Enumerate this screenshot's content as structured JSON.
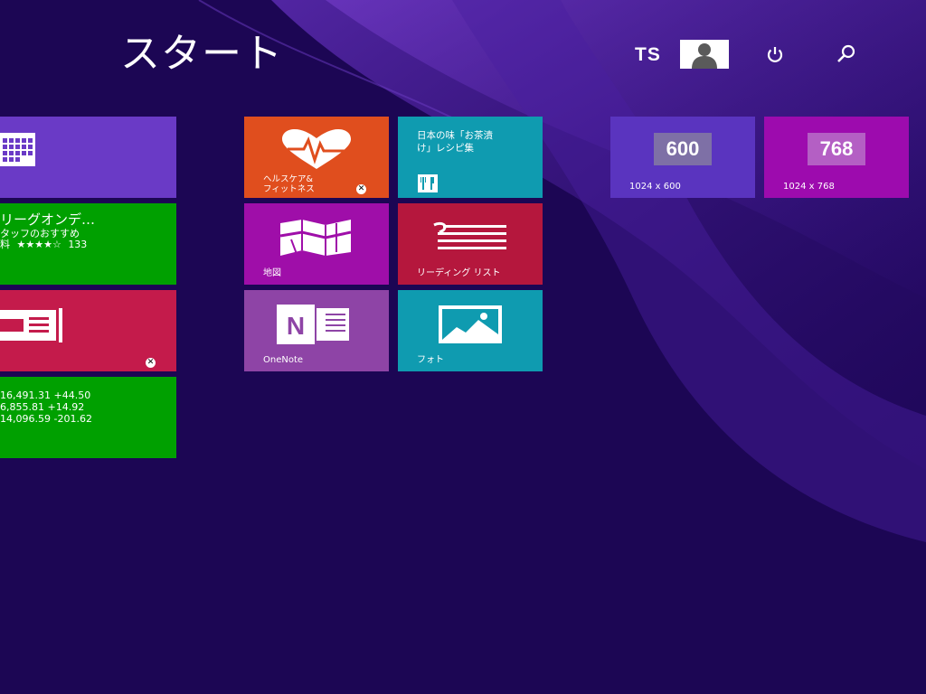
{
  "header": {
    "title": "スタート",
    "user_initials": "TS"
  },
  "colors": {
    "background": "#1c0654",
    "tile_purple": "#6a3ac6",
    "tile_green": "#00a000",
    "tile_crimson": "#c41b4b",
    "tile_orange": "#e04e1e",
    "tile_teal": "#0f9bb0",
    "tile_magenta": "#9f0ea9",
    "tile_onenote": "#8e44a6",
    "tile_reading": "#b5173d",
    "tile_res_1024_600": "#5a34bf",
    "tile_res_1024_768": "#9d0bae"
  },
  "icons": {
    "power": "power-icon",
    "search": "search-icon",
    "avatar": "person-icon"
  },
  "tiles": {
    "calendar": {
      "icon": "calendar-icon"
    },
    "sports": {
      "title": "リーグオンデ…",
      "subtitle": "タッフのおすすめ",
      "rating_prefix": "料",
      "stars": "★★★★☆",
      "rating_count": "133"
    },
    "news": {
      "icon": "news-icon"
    },
    "finance": {
      "rows": [
        "16,491.31 +44.50",
        "6,855.81 +14.92",
        "14,096.59 -201.62"
      ]
    },
    "health": {
      "label_line1": "ヘルスケア&",
      "label_line2": "フィットネス",
      "icon": "heart-pulse-icon"
    },
    "food": {
      "title_line1": "日本の味「お茶漬",
      "title_line2": "け」レシピ集",
      "icon": "fork-knife-icon"
    },
    "maps": {
      "label": "地図",
      "icon": "map-icon"
    },
    "reading_list": {
      "label": "リーディング リスト",
      "icon": "reading-list-icon"
    },
    "onenote": {
      "label": "OneNote",
      "icon": "onenote-icon"
    },
    "photos": {
      "label": "フォト",
      "icon": "photo-icon"
    },
    "res600": {
      "big": "600",
      "label": "1024 x 600"
    },
    "res768": {
      "big": "768",
      "label": "1024 x 768"
    }
  }
}
